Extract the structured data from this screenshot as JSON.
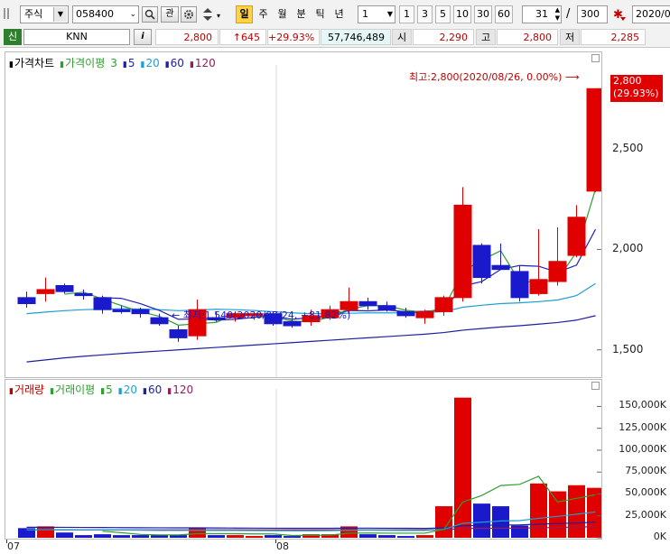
{
  "toolbar": {
    "market_type": "주식",
    "stock_code": "058400",
    "btn_search_icon": "search-icon",
    "btn_gwan": "관",
    "period_tabs": [
      "일",
      "주",
      "월",
      "분",
      "틱",
      "년"
    ],
    "period_selected": "일",
    "interval_value": "1",
    "interval_buttons": [
      "1",
      "3",
      "5",
      "10",
      "30",
      "60"
    ],
    "count_value": "31",
    "count_total": "300",
    "slash": "/",
    "date_value": "2020/0"
  },
  "quote": {
    "credit_badge": "신",
    "stock_name": "KNN",
    "info_button": "i",
    "price": "2,800",
    "change": "↑645",
    "change_rate": "+29.93%",
    "volume": "57,746,489",
    "open_label": "시",
    "open": "2,290",
    "high_label": "고",
    "high": "2,800",
    "low_label": "저",
    "low": "2,285"
  },
  "price_panel": {
    "legend": [
      {
        "text": "가격차트",
        "color": "#000000"
      },
      {
        "text": "가격이평",
        "color": "#2f9e2f"
      },
      {
        "text": "3",
        "color": "#2f9e2f"
      },
      {
        "text": "5",
        "color": "#1f1fbf"
      },
      {
        "text": "20",
        "color": "#1f9fd0"
      },
      {
        "text": "60",
        "color": "#1f1f9f"
      },
      {
        "text": "120",
        "color": "#8f1f5f"
      }
    ],
    "y_ticks": [
      "2,500",
      "2,000",
      "1,500"
    ],
    "current_price_tag": "2,800",
    "current_rate_tag": "(29.93%)",
    "high_note": "최고:2,800(2020/08/26, 0.00%)",
    "low_note": "←  최저:1,540(2020/07/24, +81.82%)"
  },
  "volume_panel": {
    "legend": [
      {
        "text": "거래량",
        "color": "#c00000"
      },
      {
        "text": "거래이평",
        "color": "#2f9e2f"
      },
      {
        "text": "5",
        "color": "#2f9e2f"
      },
      {
        "text": "20",
        "color": "#1f9fd0"
      },
      {
        "text": "60",
        "color": "#1f1f9f"
      },
      {
        "text": "120",
        "color": "#8f1f5f"
      }
    ],
    "y_ticks": [
      "150,000K",
      "125,000K",
      "100,000K",
      "75,000K",
      "50,000K",
      "25,000K",
      "0K"
    ]
  },
  "x_labels": [
    "07",
    "08"
  ],
  "colors": {
    "up": "#e00000",
    "down": "#1a1acc",
    "ma3": "#2f9e2f",
    "ma5": "#1f1fbf",
    "ma20": "#1f9fd0",
    "ma60": "#1f1f9f",
    "ma120": "#8f1f5f"
  },
  "chart_data": {
    "type": "candlestick",
    "price_ylim": [
      1400,
      2900
    ],
    "volume_ylim": [
      0,
      170000
    ],
    "volume_unit": "K",
    "candles": [
      {
        "o": 1760,
        "h": 1790,
        "l": 1710,
        "c": 1730
      },
      {
        "o": 1780,
        "h": 1860,
        "l": 1740,
        "c": 1800
      },
      {
        "o": 1820,
        "h": 1830,
        "l": 1780,
        "c": 1790
      },
      {
        "o": 1780,
        "h": 1800,
        "l": 1750,
        "c": 1770
      },
      {
        "o": 1760,
        "h": 1770,
        "l": 1680,
        "c": 1700
      },
      {
        "o": 1700,
        "h": 1720,
        "l": 1680,
        "c": 1690
      },
      {
        "o": 1700,
        "h": 1710,
        "l": 1660,
        "c": 1680
      },
      {
        "o": 1660,
        "h": 1680,
        "l": 1620,
        "c": 1630
      },
      {
        "o": 1600,
        "h": 1620,
        "l": 1540,
        "c": 1560
      },
      {
        "o": 1570,
        "h": 1750,
        "l": 1550,
        "c": 1700
      },
      {
        "o": 1660,
        "h": 1690,
        "l": 1640,
        "c": 1650
      },
      {
        "o": 1660,
        "h": 1690,
        "l": 1640,
        "c": 1680
      },
      {
        "o": 1670,
        "h": 1690,
        "l": 1650,
        "c": 1680
      },
      {
        "o": 1680,
        "h": 1690,
        "l": 1620,
        "c": 1630
      },
      {
        "o": 1640,
        "h": 1650,
        "l": 1610,
        "c": 1620
      },
      {
        "o": 1640,
        "h": 1700,
        "l": 1620,
        "c": 1670
      },
      {
        "o": 1660,
        "h": 1720,
        "l": 1650,
        "c": 1700
      },
      {
        "o": 1700,
        "h": 1810,
        "l": 1680,
        "c": 1740
      },
      {
        "o": 1740,
        "h": 1760,
        "l": 1700,
        "c": 1720
      },
      {
        "o": 1720,
        "h": 1740,
        "l": 1690,
        "c": 1700
      },
      {
        "o": 1690,
        "h": 1710,
        "l": 1660,
        "c": 1670
      },
      {
        "o": 1660,
        "h": 1700,
        "l": 1630,
        "c": 1690
      },
      {
        "o": 1690,
        "h": 1770,
        "l": 1670,
        "c": 1760
      },
      {
        "o": 1760,
        "h": 2310,
        "l": 1740,
        "c": 2220
      },
      {
        "o": 2020,
        "h": 2030,
        "l": 1830,
        "c": 1860
      },
      {
        "o": 1920,
        "h": 2030,
        "l": 1900,
        "c": 1900
      },
      {
        "o": 1890,
        "h": 1920,
        "l": 1740,
        "c": 1760
      },
      {
        "o": 1780,
        "h": 2100,
        "l": 1770,
        "c": 1850
      },
      {
        "o": 1840,
        "h": 2110,
        "l": 1820,
        "c": 1940
      },
      {
        "o": 1970,
        "h": 2220,
        "l": 1960,
        "c": 2160
      },
      {
        "o": 2290,
        "h": 2800,
        "l": 2285,
        "c": 2800
      }
    ],
    "volume": [
      11000,
      13000,
      6000,
      3000,
      4000,
      3000,
      3000,
      3000,
      3000,
      11000,
      3000,
      3000,
      2000,
      3000,
      2000,
      4000,
      4000,
      13000,
      4000,
      3000,
      2000,
      3000,
      36000,
      160000,
      39000,
      36000,
      14000,
      62000,
      53000,
      60000,
      57000
    ],
    "ma3": [
      null,
      null,
      1777,
      1787,
      1753,
      1720,
      1690,
      1667,
      1623,
      1630,
      1637,
      1677,
      1670,
      1663,
      1643,
      1640,
      1663,
      1703,
      1720,
      1720,
      1697,
      1687,
      1707,
      1890,
      1947,
      1993,
      1840,
      1837,
      1850,
      1987,
      2300
    ],
    "ma5": [
      null,
      null,
      null,
      null,
      1760,
      1756,
      1730,
      1696,
      1652,
      1654,
      1648,
      1652,
      1662,
      1668,
      1652,
      1660,
      1670,
      1696,
      1694,
      1698,
      1690,
      1692,
      1698,
      1818,
      1840,
      1900,
      1920,
      1916,
      1886,
      1922,
      2100
    ],
    "ma20": [
      1680,
      1688,
      1695,
      1700,
      1702,
      1705,
      1703,
      1700,
      1695,
      1698,
      1702,
      1700,
      1696,
      1690,
      1684,
      1680,
      1680,
      1682,
      1684,
      1684,
      1684,
      1686,
      1690,
      1712,
      1722,
      1730,
      1734,
      1740,
      1748,
      1770,
      1830
    ],
    "ma60": [
      1440,
      1450,
      1460,
      1468,
      1475,
      1482,
      1488,
      1494,
      1500,
      1506,
      1512,
      1518,
      1524,
      1530,
      1536,
      1542,
      1548,
      1554,
      1560,
      1566,
      1572,
      1578,
      1586,
      1598,
      1606,
      1614,
      1620,
      1628,
      1636,
      1648,
      1670
    ],
    "ma120": [
      1265,
      1268,
      1271,
      1274,
      1277,
      1280,
      1283,
      1286,
      1289,
      1292,
      1295,
      1298,
      1301,
      1304,
      1307,
      1310,
      1313,
      1316,
      1319,
      1322,
      1325,
      1328,
      1331,
      1334,
      1337,
      1340,
      1343,
      1346,
      1349,
      1354,
      1362
    ],
    "vma5": [
      null,
      null,
      null,
      null,
      7400,
      5800,
      3800,
      3200,
      3200,
      4600,
      4600,
      4600,
      4400,
      4400,
      2600,
      2800,
      3000,
      5200,
      5400,
      5200,
      5200,
      5200,
      9600,
      40800,
      48200,
      59600,
      61000,
      70200,
      40800,
      45000,
      49200
    ],
    "vma20": [
      9000,
      9200,
      9300,
      9200,
      9000,
      8800,
      8600,
      8400,
      8300,
      8500,
      8400,
      8300,
      8200,
      8100,
      8000,
      8000,
      8100,
      8500,
      8600,
      8500,
      8400,
      8300,
      9600,
      16500,
      17800,
      19200,
      19600,
      22200,
      24400,
      26900,
      29400
    ],
    "vma60": [
      12000,
      12000,
      11900,
      11800,
      11700,
      11600,
      11500,
      11400,
      11300,
      11300,
      11200,
      11100,
      11000,
      10900,
      10800,
      10800,
      10800,
      11000,
      11000,
      10900,
      10800,
      10700,
      11200,
      13700,
      14100,
      14600,
      14700,
      15500,
      16200,
      16900,
      17700
    ],
    "vma120": [
      9000,
      9000,
      9000,
      9000,
      9000,
      9000,
      9000,
      9000,
      9000,
      9000,
      9000,
      9000,
      9000,
      9000,
      9000,
      9000,
      9000,
      9100,
      9100,
      9100,
      9100,
      9100,
      9300,
      10500,
      10700,
      10900,
      11000,
      11400,
      11800,
      12200,
      12600
    ]
  }
}
